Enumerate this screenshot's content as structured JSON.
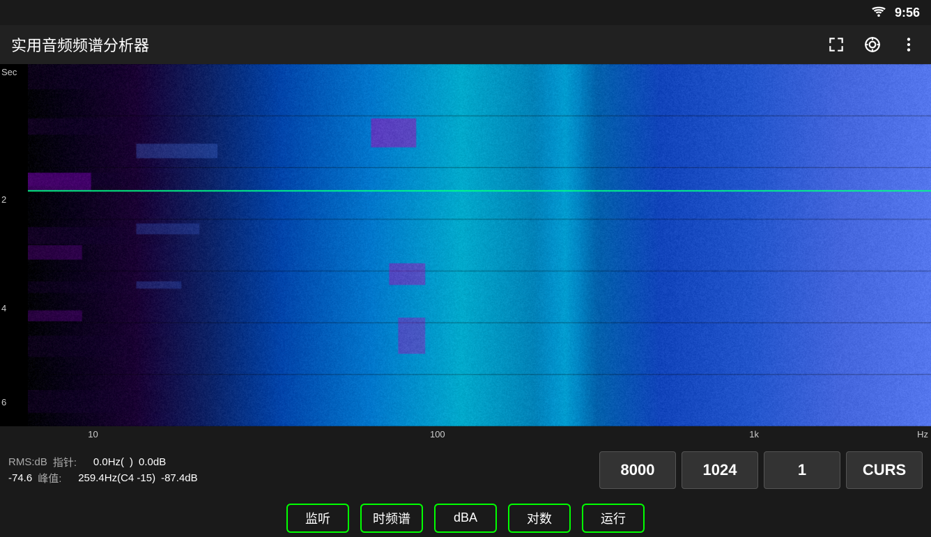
{
  "app": {
    "title": "实用音频频谱分析器",
    "status_time": "9:56"
  },
  "toolbar_icons": {
    "fullscreen": "⛶",
    "target": "◎",
    "more": "⋮"
  },
  "spectrogram": {
    "y_axis_label": "Sec",
    "y_labels": [
      {
        "value": "2",
        "top_pct": 36
      },
      {
        "value": "4",
        "top_pct": 66
      },
      {
        "value": "6",
        "top_pct": 95
      }
    ],
    "x_labels": [
      {
        "value": "10",
        "left_pct": 7
      },
      {
        "value": "100",
        "left_pct": 44
      },
      {
        "value": "1k",
        "left_pct": 78
      },
      {
        "value": "Hz",
        "is_unit": true
      }
    ]
  },
  "info_bar": {
    "rms_label": "RMS:dB",
    "rms_value": "-74.6",
    "needle_label": "指针:",
    "needle_freq": "0.0Hz(",
    "needle_note": ")",
    "needle_db": "0.0dB",
    "peak_label": "峰值:",
    "peak_freq": "259.4Hz(C4  -15)",
    "peak_db": "-87.4dB",
    "btn_8000": "8000",
    "btn_1024": "1024",
    "btn_1": "1",
    "btn_curs": "CURS"
  },
  "bottom_buttons": [
    {
      "label": "监听",
      "id": "btn-listen"
    },
    {
      "label": "时频谱",
      "id": "btn-spectrogram"
    },
    {
      "label": "dBA",
      "id": "btn-dba"
    },
    {
      "label": "对数",
      "id": "btn-log"
    },
    {
      "label": "运行",
      "id": "btn-run"
    }
  ]
}
